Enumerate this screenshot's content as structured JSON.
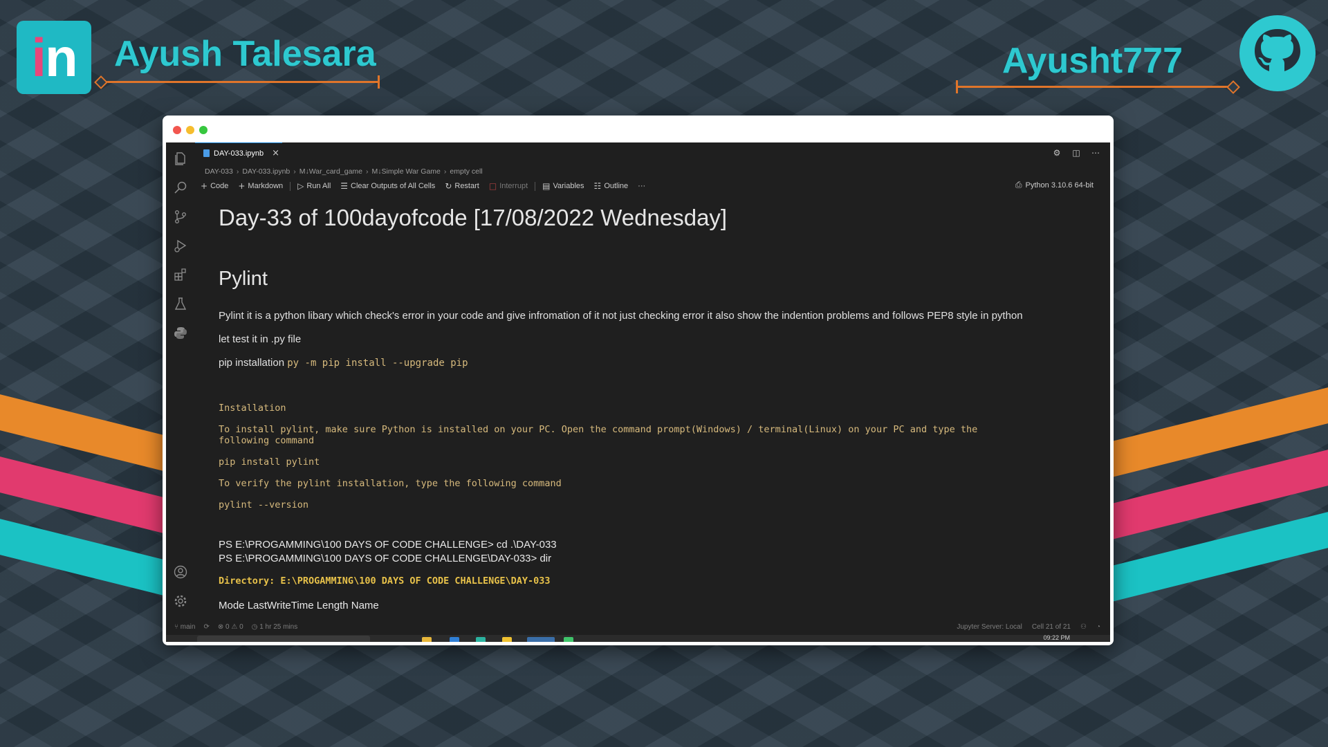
{
  "branding": {
    "linkedin_logo": "in",
    "name_left": "Ayush Talesara",
    "name_right": "Ayusht777",
    "accent_teal": "#2ec9d0",
    "accent_orange": "#e0752a",
    "icons": [
      "linkedin-icon",
      "github-icon"
    ]
  },
  "editor": {
    "tab": {
      "label": "DAY-033.ipynb",
      "close": "×"
    },
    "breadcrumb": [
      "DAY-033",
      "DAY-033.ipynb",
      "M↓War_card_game",
      "M↓Simple War Game",
      "empty cell"
    ],
    "toolbar": {
      "code": "Code",
      "markdown": "Markdown",
      "run_all": "Run All",
      "clear_outputs": "Clear Outputs of All Cells",
      "restart": "Restart",
      "interrupt": "Interrupt",
      "variables": "Variables",
      "outline": "Outline",
      "more": "···",
      "kernel": "Python 3.10.6 64-bit"
    },
    "content": {
      "title": "Day-33 of 100dayofcode [17/08/2022 Wednesday]",
      "heading": "Pylint",
      "para1": "Pylint it is a python libary which check's error in your code and give infromation of it not just checking error it also show the indention problems and follows PEP8 style in python",
      "para2": "let test it in .py file",
      "para3_text": "pip installation",
      "para3_code": "py -m pip install --upgrade pip",
      "code_block": {
        "installation": "Installation",
        "line1": "To install pylint, make sure Python is installed on your PC. Open the command prompt(Windows) / terminal(Linux) on your PC and type the",
        "line2": "following command",
        "cmd1": "pip install pylint",
        "verify": "To verify the pylint installation, type the following command",
        "cmd2": "pylint --version"
      },
      "terminal": {
        "line1": "PS E:\\PROGAMMING\\100 DAYS OF CODE CHALLENGE> cd .\\DAY-033",
        "line2": "PS E:\\PROGAMMING\\100 DAYS OF CODE CHALLENGE\\DAY-033> dir",
        "directory": "Directory: E:\\PROGAMMING\\100 DAYS OF CODE CHALLENGE\\DAY-033",
        "columns": "Mode LastWriteTime Length Name"
      }
    },
    "statusbar": {
      "branch": "main",
      "problems": "⊗ 0 ⚠ 0",
      "time": "1 hr 25 mins",
      "jupyter": "Jupyter Server: Local",
      "cell": "Cell 21 of 21"
    },
    "taskbar_time": "09:22 PM"
  }
}
